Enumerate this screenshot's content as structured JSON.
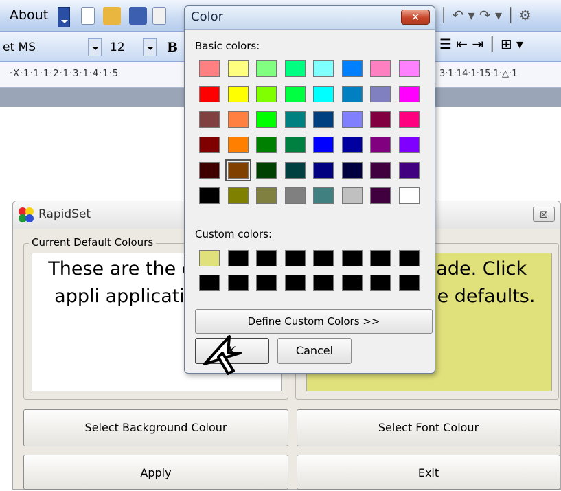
{
  "word": {
    "menu_about": "About",
    "font_name": "et MS",
    "font_size": "12",
    "bold_label": "B",
    "ruler_left": "·X·1·1·1·2·1·3·1·4·1·5",
    "ruler_right": "3·1·14·1·15·1·△·1"
  },
  "rapidset": {
    "title": "RapidSet",
    "close_label": "⊠",
    "group_label": "Current Default Colours",
    "left_preview_text": "These are the currently appli applications in V",
    "right_preview_text": "he choices ade.  Click utton to set e defaults.",
    "right_preview_bg": "#e1e17c",
    "select_bg_button": "Select Background Colour",
    "select_font_button": "Select Font Colour",
    "apply_button": "Apply",
    "exit_button": "Exit"
  },
  "color_dialog": {
    "title": "Color",
    "close_label": "✕",
    "basic_label": "Basic colors:",
    "custom_label": "Custom colors:",
    "define_button": "Define Custom Colors >>",
    "ok_button": "K",
    "cancel_button": "Cancel",
    "selected_basic_index": 33,
    "basic_colors": [
      "#ff8080",
      "#ffff80",
      "#80ff80",
      "#00ff80",
      "#80ffff",
      "#0080ff",
      "#ff80c0",
      "#ff80ff",
      "#ff0000",
      "#ffff00",
      "#80ff00",
      "#00ff40",
      "#00ffff",
      "#0080c0",
      "#8080c0",
      "#ff00ff",
      "#804040",
      "#ff8040",
      "#00ff00",
      "#008080",
      "#004080",
      "#8080ff",
      "#800040",
      "#ff0080",
      "#800000",
      "#ff8000",
      "#008000",
      "#008040",
      "#0000ff",
      "#0000a0",
      "#800080",
      "#8000ff",
      "#400000",
      "#804000",
      "#004000",
      "#004040",
      "#000080",
      "#000040",
      "#400040",
      "#400080",
      "#000000",
      "#808000",
      "#808040",
      "#808080",
      "#408080",
      "#c0c0c0",
      "#400040",
      "#ffffff"
    ],
    "custom_colors": [
      "#e1e17c",
      "#000000",
      "#000000",
      "#000000",
      "#000000",
      "#000000",
      "#000000",
      "#000000",
      "#000000",
      "#000000",
      "#000000",
      "#000000",
      "#000000",
      "#000000",
      "#000000",
      "#000000"
    ]
  }
}
